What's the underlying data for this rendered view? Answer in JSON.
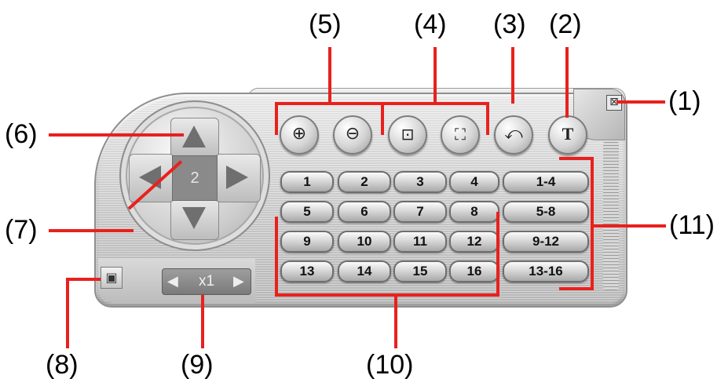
{
  "callouts": {
    "c1": "(1)",
    "c2": "(2)",
    "c3": "(3)",
    "c4": "(4)",
    "c5": "(5)",
    "c6": "(6)",
    "c7": "(7)",
    "c8": "(8)",
    "c9": "(9)",
    "c10": "(10)",
    "c11": "(11)"
  },
  "ptz": {
    "camera_number": "2"
  },
  "close_glyph": "⊠",
  "top_buttons": {
    "zoom_in": "⊕",
    "zoom_out": "⊖",
    "focus_in": "⊡",
    "focus_out": "⛶",
    "auto_pan": "⤺",
    "setup": "T"
  },
  "channels": [
    "1",
    "2",
    "3",
    "4",
    "5",
    "6",
    "7",
    "8",
    "9",
    "10",
    "11",
    "12",
    "13",
    "14",
    "15",
    "16"
  ],
  "groups": [
    "1-4",
    "5-8",
    "9-12",
    "13-16"
  ],
  "speed": {
    "left": "◀",
    "value": "x1",
    "right": "▶"
  },
  "save_glyph": "▣",
  "colors": {
    "callout_line": "#e8211d",
    "panel": "#cfcfcf",
    "dpad_center": "#8a8a8a"
  }
}
